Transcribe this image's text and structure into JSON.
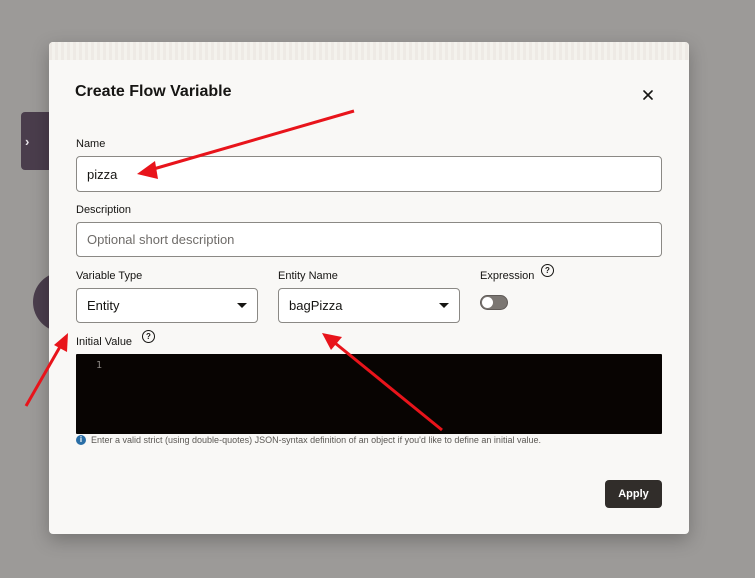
{
  "background": {
    "tab_chevron": "›"
  },
  "dialog": {
    "title": "Create Flow Variable",
    "close_icon": "close-icon",
    "name": {
      "label": "Name",
      "value": "pizza"
    },
    "description": {
      "label": "Description",
      "placeholder": "Optional short description",
      "value": ""
    },
    "variable_type": {
      "label": "Variable Type",
      "selected": "Entity"
    },
    "entity_name": {
      "label": "Entity Name",
      "selected": "bagPizza"
    },
    "expression": {
      "label": "Expression",
      "help": "?",
      "enabled": false
    },
    "initial_value": {
      "label": "Initial Value",
      "help": "?",
      "line_number": "1",
      "hint_icon": "i",
      "hint": "Enter a valid strict (using double-quotes) JSON-syntax definition of an object if you'd like to define an initial value."
    },
    "apply_label": "Apply"
  },
  "colors": {
    "overlay": "#9c9a98",
    "dialog_bg": "#f9f8f6",
    "apply_bg": "#312d2a",
    "editor_bg": "#080402",
    "annotation_arrow": "#e8141b",
    "info_blue": "#2a6ea6"
  }
}
